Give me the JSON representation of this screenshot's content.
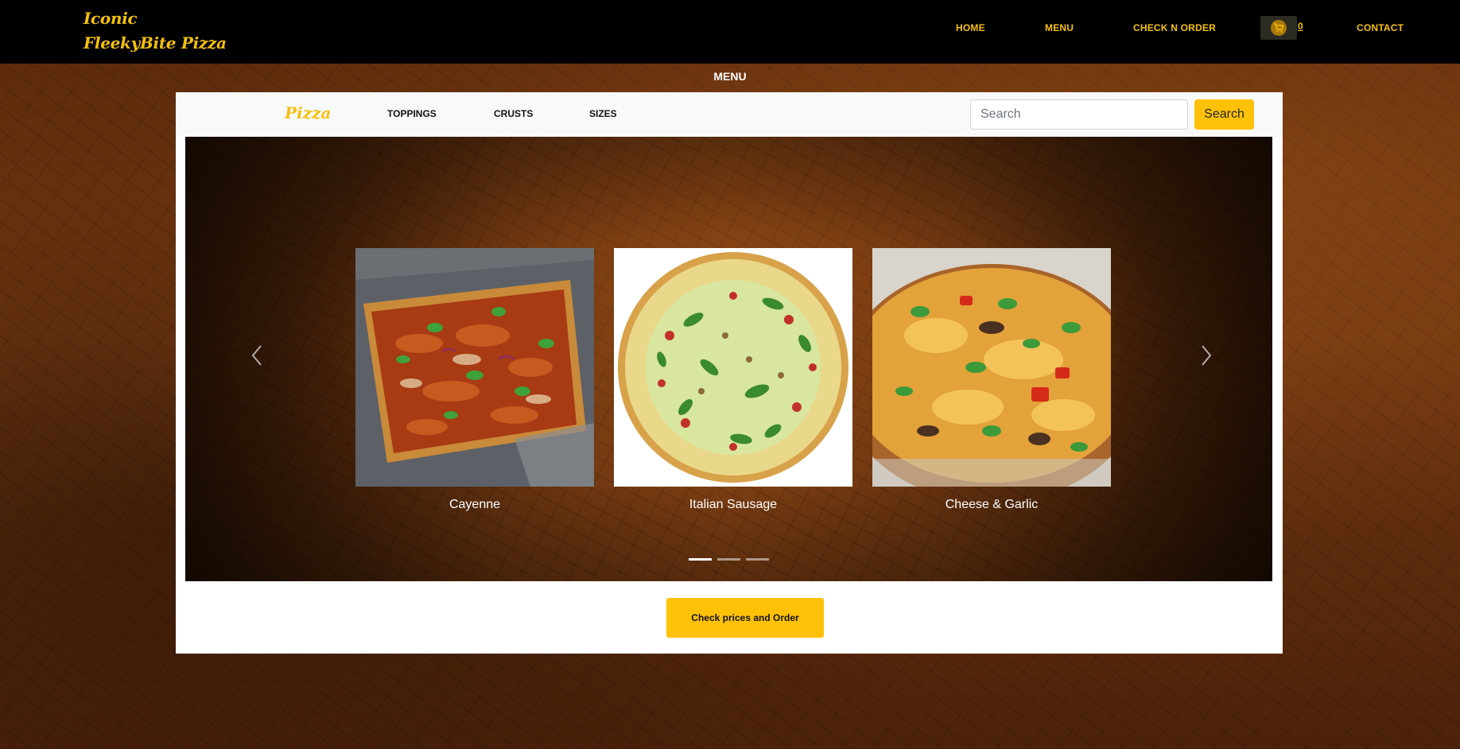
{
  "brand": {
    "line1": "Iconic",
    "line2": "FleekyBite Pizza"
  },
  "nav": {
    "home": "HOME",
    "menu": "MENU",
    "check_order": "CHECK N ORDER",
    "cart_count": "0",
    "contact": "CONTACT",
    "cart_icon": "cart-icon"
  },
  "page_heading": "MENU",
  "subnav": {
    "brand": "Pizza",
    "toppings": "TOPPINGS",
    "crusts": "CRUSTS",
    "sizes": "SIZES",
    "search_placeholder": "Search",
    "search_button": "Search"
  },
  "carousel": {
    "items": [
      {
        "caption": "Cayenne"
      },
      {
        "caption": "Italian Sausage"
      },
      {
        "caption": "Cheese & Garlic"
      }
    ],
    "indicator_count": 3,
    "active_index": 0
  },
  "order_button": "Check prices and Order",
  "colors": {
    "accent": "#ffc107",
    "brand": "#f5c010",
    "navbar": "#000000"
  }
}
